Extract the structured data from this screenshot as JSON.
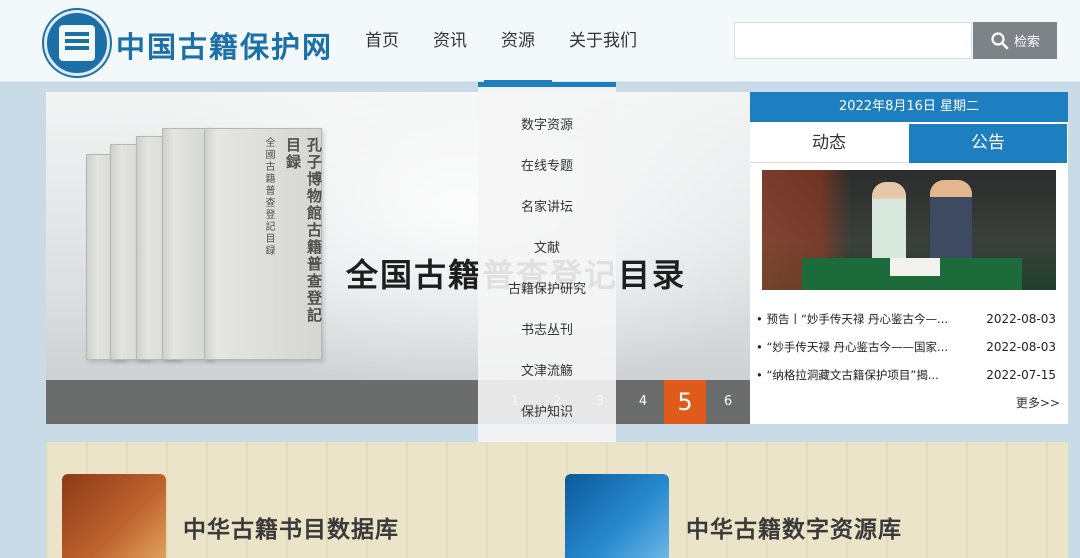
{
  "site": {
    "title": "中国古籍保护网"
  },
  "nav": {
    "items": [
      "首页",
      "资讯",
      "资源",
      "关于我们"
    ]
  },
  "search": {
    "placeholder": "",
    "button_label": "检索"
  },
  "dropdown": {
    "items": [
      "数字资源",
      "在线专题",
      "名家讲坛",
      "文献",
      "古籍保护研究",
      "书志丛刊",
      "文津流觞",
      "保护知识"
    ]
  },
  "banner": {
    "headline": "全国古籍普查登记目录",
    "pages": [
      "1",
      "2",
      "3",
      "4",
      "5",
      "6"
    ],
    "active_page": "5",
    "book_titles": [
      "孔子博物館古籍普查登記目録",
      "全國古籍普查登記目録"
    ]
  },
  "news": {
    "date": "2022年8月16日 星期二",
    "tabs": [
      "动态",
      "公告"
    ],
    "items": [
      {
        "title": "• 预告丨“妙手传天禄 丹心鉴古今—...",
        "date": "2022-08-03"
      },
      {
        "title": "• “妙手传天禄 丹心鉴古今——国家...",
        "date": "2022-08-03"
      },
      {
        "title": "• “纳格拉洞藏文古籍保护项目”揭...",
        "date": "2022-07-15"
      }
    ],
    "more_label": "更多>>"
  },
  "databases": [
    {
      "title": "中华古籍书目数据库"
    },
    {
      "title": "中华古籍数字资源库"
    }
  ],
  "colors": {
    "brand_blue": "#1d7fc0",
    "active_orange": "#e05a1a",
    "search_button": "#7d8388"
  }
}
